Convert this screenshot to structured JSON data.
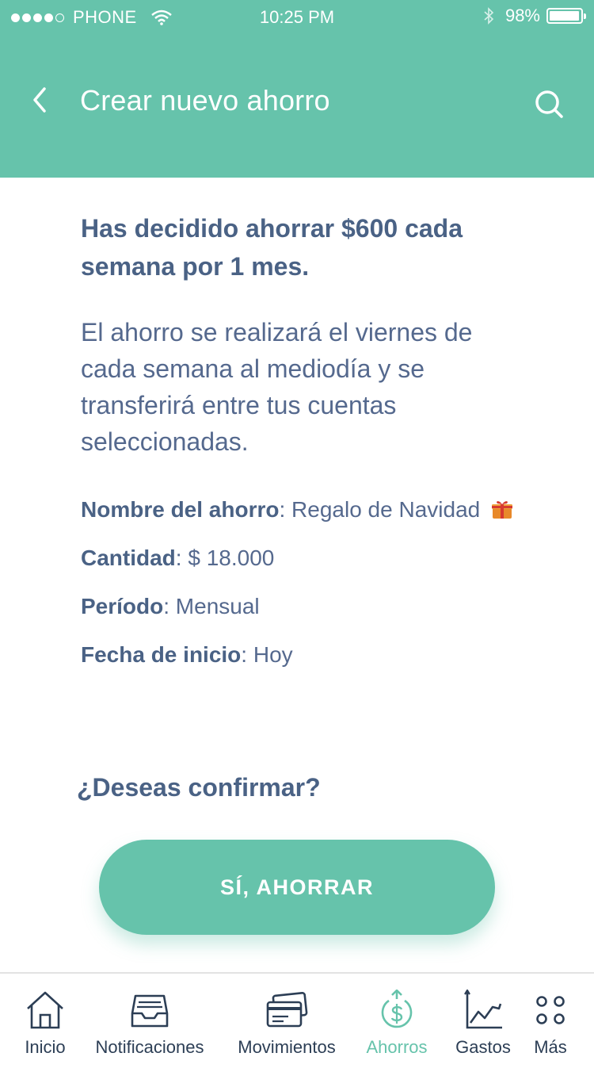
{
  "status_bar": {
    "carrier": "PHONE",
    "time": "10:25 PM",
    "battery_percent": "98%",
    "battery_level": 0.98,
    "signal_bars": 4,
    "signal_max": 5
  },
  "header": {
    "title": "Crear nuevo ahorro",
    "back_icon": "chevron-left-icon",
    "search_icon": "search-icon",
    "background_color": "#66c3ab"
  },
  "content": {
    "summary": "Has decidido ahorrar $600 cada semana por 1 mes.",
    "description": "El ahorro se realizará el viernes de cada semana al mediodía y se transferirá entre tus cuentas seleccionadas.",
    "details": [
      {
        "label": "Nombre del ahorro",
        "value": "Regalo de Navidad",
        "icon": "gift-icon"
      },
      {
        "label": "Cantidad",
        "value": "$ 18.000"
      },
      {
        "label": "Período",
        "value": "Mensual"
      },
      {
        "label": "Fecha de inicio",
        "value": "Hoy"
      }
    ],
    "confirm_question": "¿Deseas confirmar?",
    "confirm_button": "SÍ, AHORRAR"
  },
  "tabbar": {
    "active_tab": "Ahorros",
    "active_color": "#66c3ab",
    "tabs": [
      {
        "label": "Inicio",
        "icon": "home-icon"
      },
      {
        "label": "Notificaciones",
        "icon": "inbox-icon"
      },
      {
        "label": "Movimientos",
        "icon": "cards-icon"
      },
      {
        "label": "Ahorros",
        "icon": "savings-icon"
      },
      {
        "label": "Gastos",
        "icon": "chart-icon"
      },
      {
        "label": "Más",
        "icon": "more-icon"
      }
    ]
  }
}
